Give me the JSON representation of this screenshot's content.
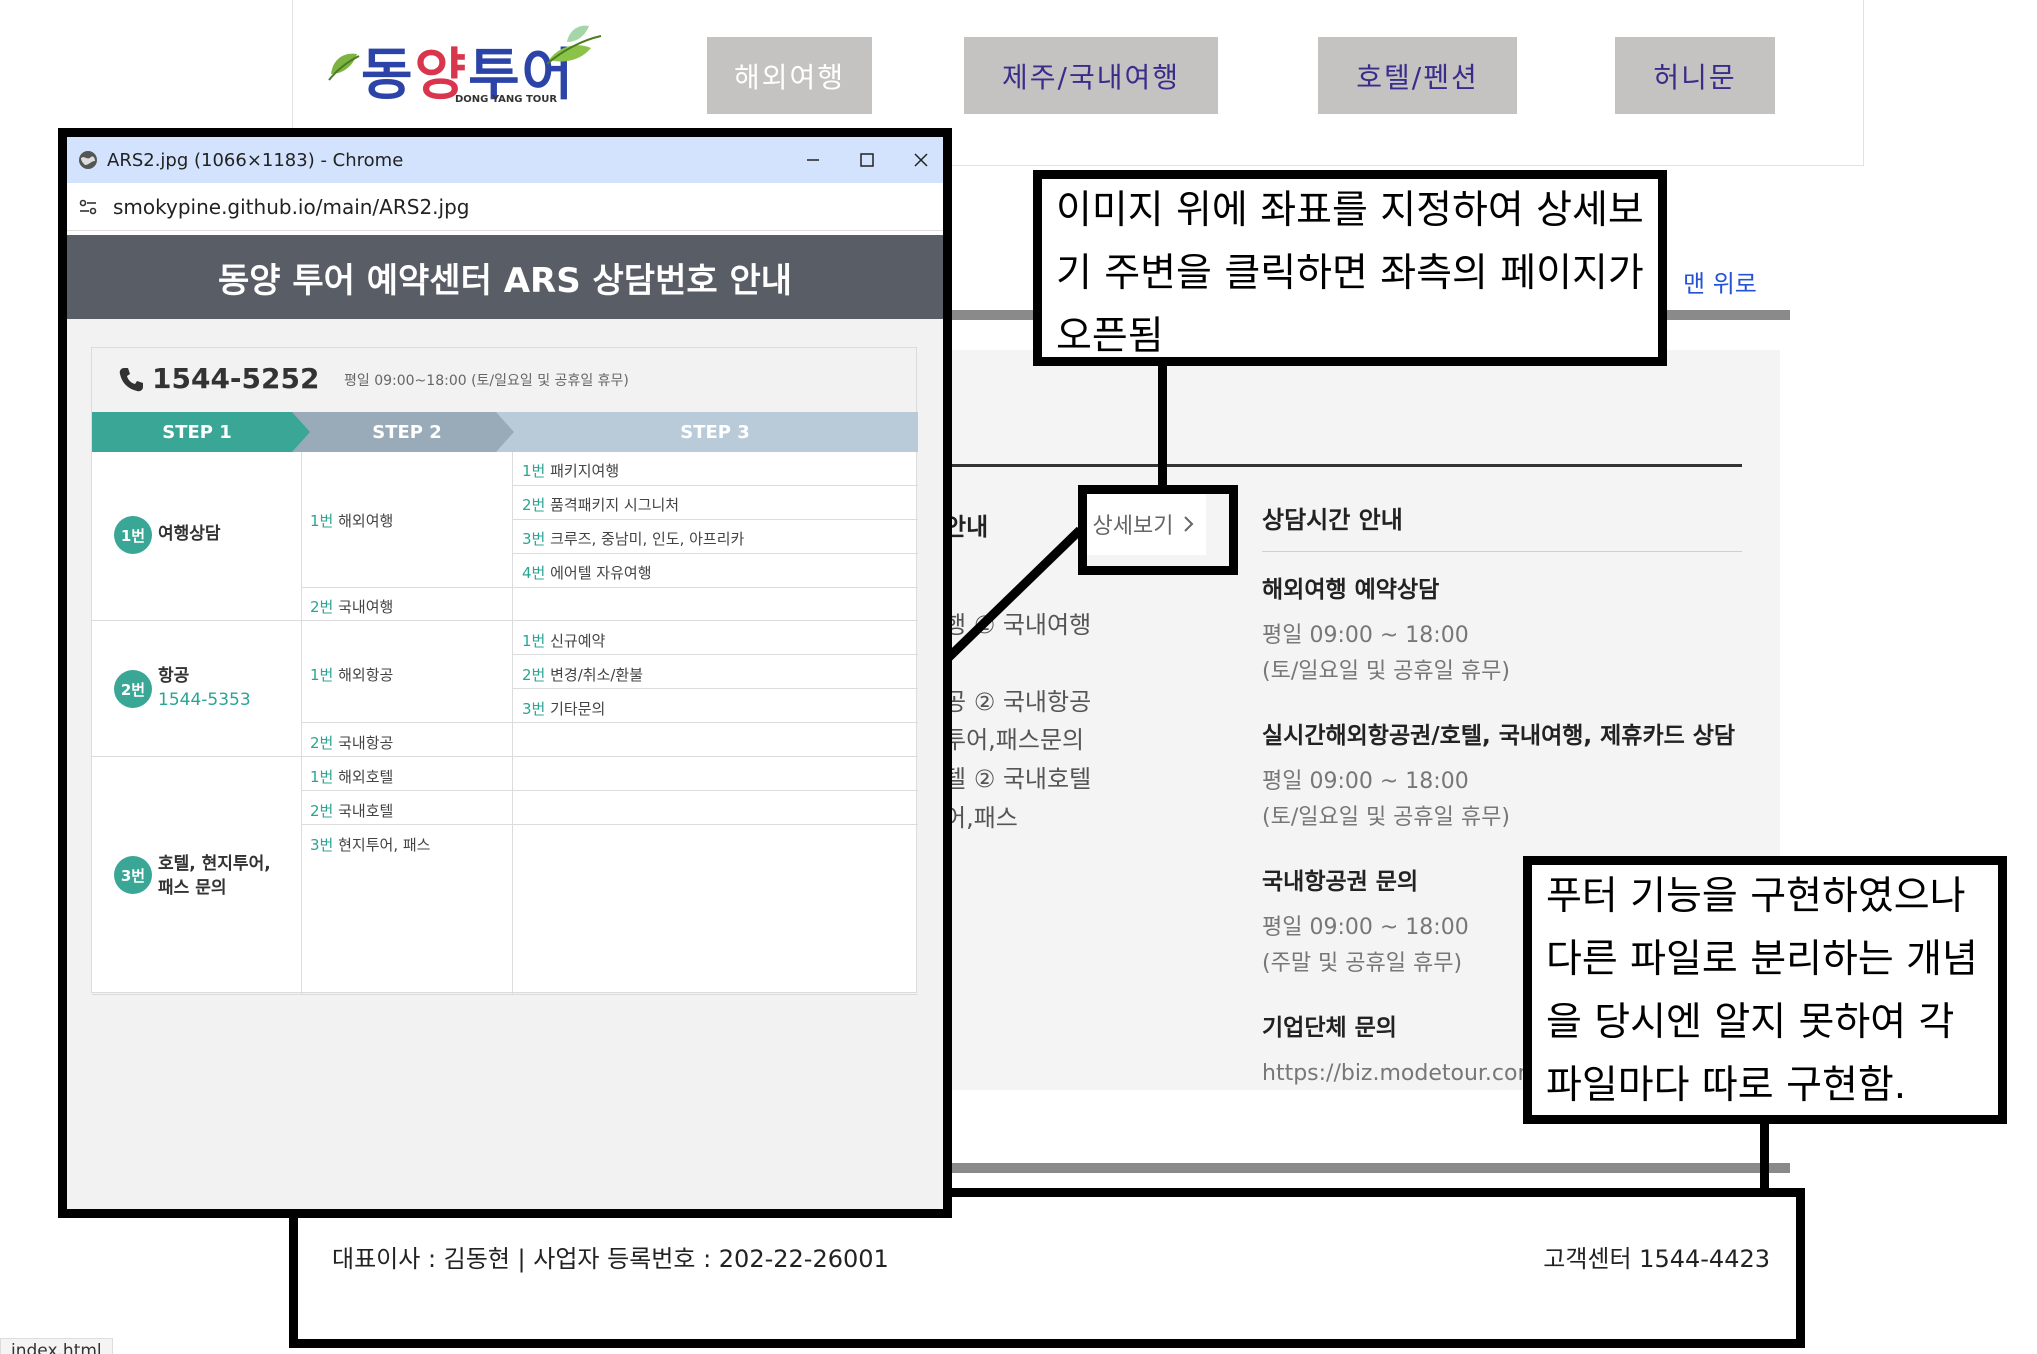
{
  "header": {
    "logo_text": "동양투어",
    "logo_sub": "DONG YANG TOUR",
    "nav": [
      "해외여행",
      "제주/국내여행",
      "호텔/펜션",
      "허니문"
    ]
  },
  "main": {
    "top_link": "맨 위로",
    "partial_title": "안내",
    "detail_button": "상세보기",
    "partial_lines": [
      "행 ② 국내여행",
      "공 ② 국내항공",
      "투어,패스문의",
      "텔 ② 국내호텔",
      "어,패스"
    ],
    "schedule": {
      "title": "상담시간 안내",
      "sections": [
        {
          "title": "해외여행 예약상담",
          "lines": [
            "평일 09:00 ~ 18:00",
            "(토/일요일 및 공휴일 휴무)"
          ]
        },
        {
          "title": "실시간해외항공권/호텔, 국내여행, 제휴카드 상담",
          "lines": [
            "평일 09:00 ~ 18:00",
            "(토/일요일 및 공휴일 휴무)"
          ]
        },
        {
          "title": "국내항공권 문의",
          "lines": [
            "평일 09:00 ~ 18:00",
            "(주말 및 공휴일 휴무)"
          ]
        },
        {
          "title": "기업단체 문의",
          "lines": [
            "https://biz.modetour.com"
          ]
        }
      ]
    }
  },
  "footer": {
    "left": "대표이사 : 김동현 | 사업자 등록번호 : 202-22-26001",
    "right": "고객센터 1544-4423"
  },
  "callouts": {
    "top": [
      "이미지 위에 좌표를 지정하여 상세보",
      "기 주변을 클릭하면 좌측의 페이지가",
      "오픈됨"
    ],
    "bottom": [
      "푸터 기능을 구현하였으나",
      "다른 파일로 분리하는 개념",
      "을 당시엔 알지 못하여 각",
      "파일마다 따로 구현함."
    ]
  },
  "popup": {
    "title": "ARS2.jpg (1066×1183) - Chrome",
    "url": "smokypine.github.io/main/ARS2.jpg",
    "banner": "동양 투어 예약센터 ARS 상담번호 안내",
    "phone": "1544-5252",
    "hours": "평일 09:00~18:00 (토/일요일 및 공휴일 휴무)",
    "steps": [
      "STEP 1",
      "STEP 2",
      "STEP 3"
    ],
    "cats": [
      {
        "badge": "1번",
        "label": "여행상담",
        "tel": ""
      },
      {
        "badge": "2번",
        "label": "항공",
        "tel": "1544-5353"
      },
      {
        "badge": "3번",
        "label1": "호텔, 현지투어,",
        "label2": "패스 문의"
      }
    ],
    "step2": [
      {
        "num": "1번",
        "text": "해외여행"
      },
      {
        "num": "2번",
        "text": "국내여행"
      },
      {
        "num": "1번",
        "text": "해외항공"
      },
      {
        "num": "2번",
        "text": "국내항공"
      },
      {
        "num": "1번",
        "text": "해외호텔"
      },
      {
        "num": "2번",
        "text": "국내호텔"
      },
      {
        "num": "3번",
        "text": "현지투어, 패스"
      }
    ],
    "step3": [
      {
        "num": "1번",
        "text": "패키지여행"
      },
      {
        "num": "2번",
        "text": "품격패키지 시그니처"
      },
      {
        "num": "3번",
        "text": "크루즈, 중남미, 인도, 아프리카"
      },
      {
        "num": "4번",
        "text": "에어텔 자유여행"
      },
      {
        "num": "1번",
        "text": "신규예약"
      },
      {
        "num": "2번",
        "text": "변경/취소/환불"
      },
      {
        "num": "3번",
        "text": "기타문의"
      }
    ]
  },
  "status_bar": "index.html",
  "colors": {
    "teal": "#3aa796",
    "nav_bg": "#c5c2c2",
    "nav_text": "#3a2d8a",
    "link": "#2453d6"
  }
}
